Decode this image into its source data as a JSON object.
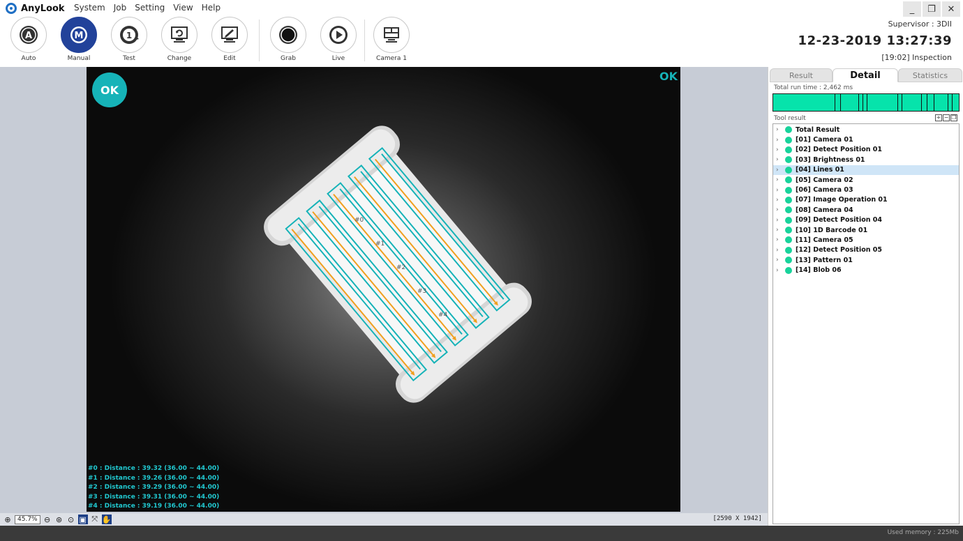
{
  "app": {
    "name": "AnyLook",
    "menu": [
      "System",
      "Job",
      "Setting",
      "View",
      "Help"
    ]
  },
  "toolbar": {
    "buttons": [
      {
        "label": "Auto",
        "glyph": "A",
        "icon": "auto-mode-icon"
      },
      {
        "label": "Manual",
        "glyph": "M",
        "icon": "manual-mode-icon",
        "active": true
      },
      {
        "label": "Test",
        "glyph": "1",
        "icon": "test-icon"
      },
      {
        "label": "Change",
        "glyph": "",
        "icon": "change-icon"
      },
      {
        "label": "Edit",
        "glyph": "",
        "icon": "edit-icon"
      },
      {
        "label": "Grab",
        "glyph": "",
        "icon": "grab-icon"
      },
      {
        "label": "Live",
        "glyph": "",
        "icon": "live-play-icon"
      },
      {
        "label": "Camera 1",
        "glyph": "",
        "icon": "camera-layout-icon"
      }
    ]
  },
  "window_controls": [
    "_",
    "❐",
    "✕"
  ],
  "header": {
    "supervisor": "Supervisor : 3DII",
    "datetime": "12-23-2019 13:27:39",
    "inspection": "[19:02] Inspection"
  },
  "viewer": {
    "result_badge": "OK",
    "result_corner": "OK",
    "roi_labels": [
      "#0",
      "#1",
      "#2",
      "#3",
      "#4"
    ],
    "distances": [
      "#0 : Distance : 39.32 (36.00 ~ 44.00)",
      "#1 : Distance : 39.26 (36.00 ~ 44.00)",
      "#2 : Distance : 39.29 (36.00 ~ 44.00)",
      "#3 : Distance : 39.31 (36.00 ~ 44.00)",
      "#4 : Distance : 39.19 (36.00 ~ 44.00)"
    ],
    "accent_color": "#16b3b8",
    "line_color": "#f0a020"
  },
  "zoombar": {
    "zoom": "45.7%",
    "image_size": "[2590 X 1942]"
  },
  "panel": {
    "tabs": [
      "Result",
      "Detail",
      "Statistics"
    ],
    "active_tab": "Detail",
    "run_time": "Total run time : 2,462 ms",
    "tool_result_label": "Tool result",
    "status_color": "#06e3ab",
    "tree": [
      "Total Result",
      "[01] Camera 01",
      "[02] Detect Position 01",
      "[03] Brightness 01",
      "[04] Lines 01",
      "[05] Camera 02",
      "[06] Camera 03",
      "[07] Image Operation 01",
      "[08] Camera 04",
      "[09] Detect Position 04",
      "[10] 1D Barcode 01",
      "[11] Camera 05",
      "[12] Detect Position 05",
      "[13] Pattern 01",
      "[14] Blob 06"
    ],
    "selected_index": 4
  },
  "status": {
    "memory": "Used memory : 225Mb"
  }
}
